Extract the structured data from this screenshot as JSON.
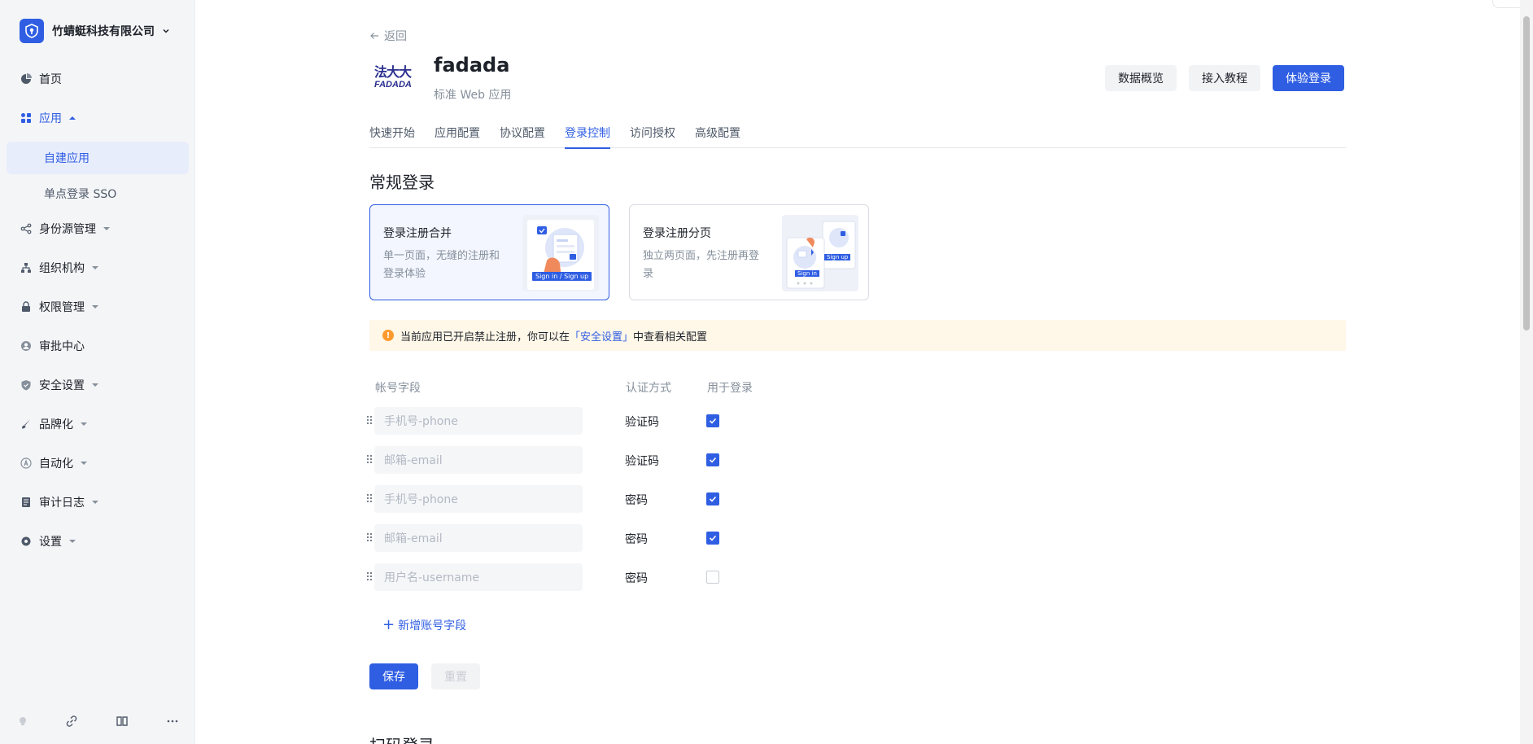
{
  "org": {
    "name": "竹蜻蜓科技有限公司"
  },
  "sidebar": {
    "items": [
      {
        "label": "首页"
      },
      {
        "label": "应用",
        "children": [
          {
            "label": "自建应用"
          },
          {
            "label": "单点登录 SSO"
          }
        ]
      },
      {
        "label": "身份源管理"
      },
      {
        "label": "组织机构"
      },
      {
        "label": "权限管理"
      },
      {
        "label": "审批中心"
      },
      {
        "label": "安全设置"
      },
      {
        "label": "品牌化"
      },
      {
        "label": "自动化"
      },
      {
        "label": "审计日志"
      },
      {
        "label": "设置"
      }
    ],
    "footer_icons": [
      "bulb-icon",
      "link-icon",
      "book-icon",
      "more-icon"
    ]
  },
  "header": {
    "back_label": "返回",
    "app_title": "fadada",
    "app_subtitle": "标准 Web 应用",
    "logo_text_cn": "法大大",
    "logo_text_en": "FADADA",
    "buttons": {
      "overview": "数据概览",
      "tutorial": "接入教程",
      "try_login": "体验登录"
    }
  },
  "tabs": [
    "快速开始",
    "应用配置",
    "协议配置",
    "登录控制",
    "访问授权",
    "高级配置"
  ],
  "active_tab": "登录控制",
  "section": {
    "title": "常规登录",
    "cards": [
      {
        "title": "登录注册合并",
        "desc": "单一页面，无缝的注册和登录体验",
        "image_label": "Sign in / Sign up",
        "active": true
      },
      {
        "title": "登录注册分页",
        "desc": "独立两页面，先注册再登录",
        "image_label_1": "Sign in",
        "image_label_2": "Sign up",
        "active": false
      }
    ],
    "notice": {
      "before": "当前应用已开启禁止注册，你可以在",
      "link": "「安全设置」",
      "after": "中查看相关配置"
    },
    "table": {
      "headers": {
        "field": "帐号字段",
        "auth": "认证方式",
        "login": "用于登录"
      },
      "rows": [
        {
          "field": "手机号-phone",
          "auth": "验证码",
          "checked": true
        },
        {
          "field": "邮箱-email",
          "auth": "验证码",
          "checked": true
        },
        {
          "field": "手机号-phone",
          "auth": "密码",
          "checked": true
        },
        {
          "field": "邮箱-email",
          "auth": "密码",
          "checked": true
        },
        {
          "field": "用户名-username",
          "auth": "密码",
          "checked": false
        }
      ]
    },
    "add_label": "新增账号字段",
    "save_label": "保存",
    "reset_label": "重置"
  },
  "next_section_title": "扫码登录",
  "colors": {
    "accent": "#2f5ee3",
    "warning": "#ff9a2e",
    "notice_bg": "#fff7e8"
  }
}
